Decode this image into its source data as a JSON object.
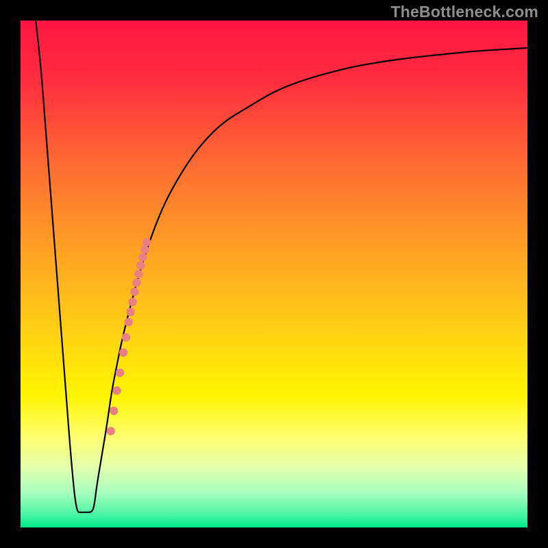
{
  "watermark": "TheBottleneck.com",
  "chart_data": {
    "type": "line",
    "title": "",
    "xlabel": "",
    "ylabel": "",
    "xlim": [
      0,
      100
    ],
    "ylim": [
      0,
      100
    ],
    "background": {
      "type": "vertical-gradient",
      "stops": [
        {
          "pos": 0.0,
          "color": "#ff1642"
        },
        {
          "pos": 0.12,
          "color": "#ff2e3f"
        },
        {
          "pos": 0.28,
          "color": "#ff6a33"
        },
        {
          "pos": 0.45,
          "color": "#ffa024"
        },
        {
          "pos": 0.62,
          "color": "#ffd313"
        },
        {
          "pos": 0.74,
          "color": "#fff502"
        },
        {
          "pos": 0.82,
          "color": "#feff6e"
        },
        {
          "pos": 0.88,
          "color": "#e4ffac"
        },
        {
          "pos": 0.93,
          "color": "#aaffbe"
        },
        {
          "pos": 0.97,
          "color": "#56f6a8"
        },
        {
          "pos": 1.0,
          "color": "#00e98b"
        }
      ]
    },
    "series": [
      {
        "name": "bottleneck-curve",
        "color": "#000000",
        "width": 2.2,
        "x": [
          3,
          4,
          5,
          6,
          7,
          8,
          9,
          10,
          11,
          12,
          13,
          14,
          14.5,
          15,
          16,
          17,
          18,
          19,
          20,
          22,
          24,
          26,
          28,
          30,
          33,
          36,
          40,
          45,
          50,
          55,
          60,
          66,
          72,
          78,
          84,
          90,
          95,
          100
        ],
        "y": [
          100,
          91,
          78,
          65,
          52,
          39,
          26,
          13,
          3,
          3,
          3,
          3,
          4,
          8,
          14,
          20,
          27,
          32,
          37,
          45,
          52,
          58,
          63,
          67,
          72,
          76,
          80,
          83,
          86,
          88,
          89.5,
          91,
          92,
          92.8,
          93.4,
          94,
          94.3,
          94.6
        ]
      }
    ],
    "points": {
      "name": "highlighted-points",
      "color": "#e98081",
      "radius": 6.2,
      "x": [
        17.8,
        18.4,
        19.0,
        19.6,
        20.3,
        20.8,
        21.3,
        21.7,
        22.1,
        22.5,
        22.9,
        23.3,
        23.7,
        24.1,
        24.5,
        24.9
      ],
      "y": [
        19.0,
        23.0,
        27.0,
        30.5,
        34.5,
        37.5,
        40.5,
        42.5,
        44.5,
        46.5,
        48.3,
        50.0,
        51.7,
        53.3,
        54.8,
        56.3
      ]
    }
  }
}
